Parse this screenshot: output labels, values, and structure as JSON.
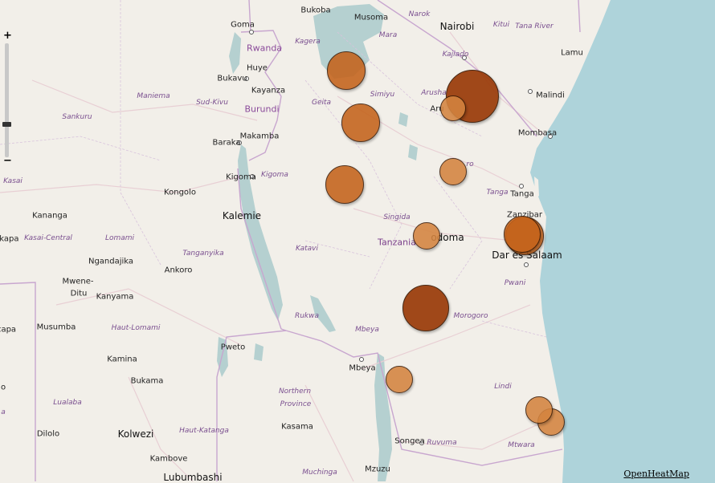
{
  "map": {
    "zoom_plus": "+",
    "zoom_minus": "−",
    "attribution": "OpenHeatMap",
    "colors": {
      "land": "#f2efe9",
      "water": "#aed3da",
      "lake": "#b5d0d0",
      "border": "#c8a6cf",
      "road": "#e8cfd4",
      "bubble_light": "#d4843f",
      "bubble_mid": "#c4621a",
      "bubble_dark": "#9a3a08"
    },
    "labels": {
      "bukoba": "Bukoba",
      "musoma": "Musoma",
      "narok": "Narok",
      "nairobi": "Nairobi",
      "kitui": "Kitui",
      "tana_river": "Tana River",
      "goma": "Goma",
      "rwanda": "Rwanda",
      "kagera": "Kagera",
      "mara": "Mara",
      "kajiado": "Kajiado",
      "lamu": "Lamu",
      "huye": "Huye",
      "bukavu": "Bukavu",
      "kayanza": "Kayanza",
      "maniema": "Maniema",
      "sud_kivu": "Sud-Kivu",
      "burundi": "Burundi",
      "geita": "Geita",
      "simiyu": "Simiyu",
      "arusha_region": "Arusha",
      "arusha": "Aru",
      "malindi": "Malindi",
      "sankuru": "Sankuru",
      "baraka": "Baraka",
      "makamba": "Makamba",
      "mombasa": "Mombasa",
      "kilimanjaro_region": "ro",
      "kasai": "Kasai",
      "kigoma": "Kigoma",
      "kigoma_region": "Kigoma",
      "tanga_region": "Tanga",
      "tanga": "Tanga",
      "kongolo": "Kongolo",
      "kananga": "Kananga",
      "kalemie": "Kalemie",
      "singida": "Singida",
      "zanzibar": "Zanzibar",
      "kasai_central": "Kasai-Central",
      "lomami": "Lomami",
      "tanzania": "Tanzania",
      "dodoma": "odoma",
      "ikapa": "ikapa",
      "ngandajika": "Ngandajika",
      "tanganyika": "Tanganyika",
      "katavi": "Katavi",
      "dar_es_salaam": "Dar es Salaam",
      "mwene_ditu_1": "Mwene-",
      "mwene_ditu_2": "Ditu",
      "ankoro": "Ankoro",
      "pwani": "Pwani",
      "kanyama": "Kanyama",
      "rukwa": "Rukwa",
      "morogoro": "Morogoro",
      "capa": "capa",
      "musumba": "Musumba",
      "haut_lomami": "Haut-Lomami",
      "mbeya_region": "Mbeya",
      "pweto": "Pweto",
      "kamina": "Kamina",
      "mbeya": "Mbeya",
      "bukama": "Bukama",
      "northern_province_1": "Northern",
      "northern_province_2": "Province",
      "lindi": "Lindi",
      "lualaba": "Lualaba",
      "dilolo": "Dilolo",
      "kolwezi": "Kolwezi",
      "haut_katanga": "Haut-Katanga",
      "kasama": "Kasama",
      "songea": "Songea",
      "ruvuma": "Ruvuma",
      "mtwara": "Mtwara",
      "kambove": "Kambove",
      "muchinga": "Muchinga",
      "mzuzu": "Mzuzu",
      "lubumbashi": "Lubumbashi",
      "edge_o": "o",
      "edge_a": "a"
    },
    "bubbles": [
      {
        "name": "kagera-bubble",
        "size": 46,
        "tone": "mid"
      },
      {
        "name": "mwanza-bubble",
        "size": 46,
        "tone": "mid"
      },
      {
        "name": "tabora-bubble",
        "size": 46,
        "tone": "mid"
      },
      {
        "name": "arusha-bubble",
        "size": 30,
        "tone": "light"
      },
      {
        "name": "kilimanjaro-bubble",
        "size": 64,
        "tone": "dark"
      },
      {
        "name": "manyara-bubble",
        "size": 32,
        "tone": "light"
      },
      {
        "name": "dodoma-bubble",
        "size": 32,
        "tone": "light"
      },
      {
        "name": "zanzibar-bubble",
        "size": 44,
        "tone": "mid"
      },
      {
        "name": "dar-es-salaam-bubble",
        "size": 46,
        "tone": "mid"
      },
      {
        "name": "iringa-bubble",
        "size": 56,
        "tone": "dark"
      },
      {
        "name": "mbeya-bubble",
        "size": 32,
        "tone": "light"
      },
      {
        "name": "lindi-bubble",
        "size": 32,
        "tone": "light"
      },
      {
        "name": "mtwara-bubble",
        "size": 32,
        "tone": "light"
      }
    ]
  }
}
